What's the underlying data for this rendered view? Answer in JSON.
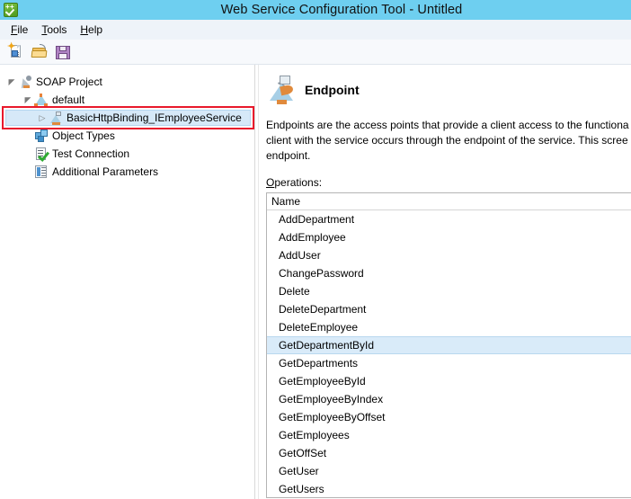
{
  "window": {
    "title": "Web Service Configuration Tool - Untitled",
    "app_icon": "green-check-plus-icon",
    "titlebar_color": "#6ecff0"
  },
  "menubar": {
    "items": [
      {
        "accel": "F",
        "rest": "ile",
        "name": "file"
      },
      {
        "accel": "T",
        "rest": "ools",
        "name": "tools"
      },
      {
        "accel": "H",
        "rest": "elp",
        "name": "help"
      }
    ]
  },
  "toolbar": {
    "buttons": [
      {
        "name": "new-document-button",
        "icon": "new-document-icon"
      },
      {
        "name": "open-file-button",
        "icon": "open-folder-icon"
      },
      {
        "name": "save-button",
        "icon": "floppy-disk-save-icon"
      }
    ]
  },
  "tree": {
    "nodes": [
      {
        "label": "SOAP Project",
        "icon": "soap-project-icon",
        "expander": "expanded",
        "indent": 0,
        "selected": false
      },
      {
        "label": "default",
        "icon": "binding-default-icon",
        "expander": "expanded",
        "indent": 1,
        "selected": false
      },
      {
        "label": "BasicHttpBinding_IEmployeeService",
        "icon": "endpoint-icon",
        "expander": "collapsed",
        "indent": 2,
        "selected": true,
        "annotation": "red-highlight-box"
      },
      {
        "label": "Object Types",
        "icon": "object-types-icon",
        "expander": "none",
        "indent": 1,
        "selected": false
      },
      {
        "label": "Test Connection",
        "icon": "test-connection-icon",
        "expander": "none",
        "indent": 1,
        "selected": false
      },
      {
        "label": "Additional Parameters",
        "icon": "additional-parameters-icon",
        "expander": "none",
        "indent": 1,
        "selected": false
      }
    ]
  },
  "detail": {
    "icon": "endpoint-large-icon",
    "title": "Endpoint",
    "description": "Endpoints are the access points that provide a client access to the functiona\nclient with the service occurs through the endpoint of the service. This scree\nendpoint.",
    "operations_label_accel": "O",
    "operations_label_rest": "perations:",
    "column_header": "Name",
    "operations": [
      {
        "name": "AddDepartment",
        "selected": false
      },
      {
        "name": "AddEmployee",
        "selected": false
      },
      {
        "name": "AddUser",
        "selected": false
      },
      {
        "name": "ChangePassword",
        "selected": false
      },
      {
        "name": "Delete",
        "selected": false
      },
      {
        "name": "DeleteDepartment",
        "selected": false
      },
      {
        "name": "DeleteEmployee",
        "selected": false
      },
      {
        "name": "GetDepartmentById",
        "selected": true
      },
      {
        "name": "GetDepartments",
        "selected": false
      },
      {
        "name": "GetEmployeeById",
        "selected": false
      },
      {
        "name": "GetEmployeeByIndex",
        "selected": false
      },
      {
        "name": "GetEmployeeByOffset",
        "selected": false
      },
      {
        "name": "GetEmployees",
        "selected": false
      },
      {
        "name": "GetOffSet",
        "selected": false
      },
      {
        "name": "GetUser",
        "selected": false
      },
      {
        "name": "GetUsers",
        "selected": false
      }
    ]
  },
  "colors": {
    "titlebar": "#6ecff0",
    "menubar": "#eef3f9",
    "selection": "#d9ebf9",
    "annotation_red": "#e8192c"
  }
}
